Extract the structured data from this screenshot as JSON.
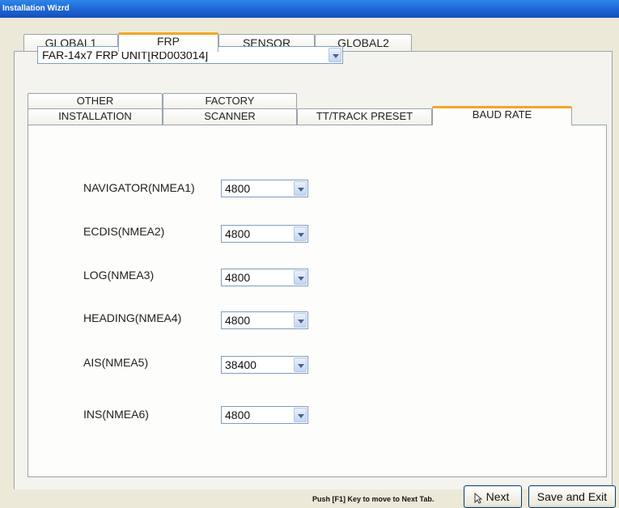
{
  "window": {
    "title": "Installation Wizrd"
  },
  "main_tabs": [
    "GLOBAL1",
    "FRP",
    "SENSOR",
    "GLOBAL2"
  ],
  "unit_select": {
    "value": "FAR-14x7 FRP UNIT[RD003014]"
  },
  "sub_tabs_row1": [
    "OTHER",
    "FACTORY"
  ],
  "sub_tabs_row2": [
    "INSTALLATION",
    "SCANNER",
    "TT/TRACK PRESET",
    "BAUD RATE"
  ],
  "baud_rates": [
    {
      "label": "NAVIGATOR(NMEA1)",
      "value": "4800"
    },
    {
      "label": "ECDIS(NMEA2)",
      "value": "4800"
    },
    {
      "label": "LOG(NMEA3)",
      "value": "4800"
    },
    {
      "label": "HEADING(NMEA4)",
      "value": "4800"
    },
    {
      "label": "AIS(NMEA5)",
      "value": "38400"
    },
    {
      "label": "INS(NMEA6)",
      "value": "4800"
    }
  ],
  "footer": {
    "hint": "Push [F1] Key to move to Next Tab.",
    "next_label": "Next",
    "save_exit_label": "Save and Exit"
  },
  "icons": {
    "dropdown": "chevron-down-icon",
    "cursor": "mouse-pointer-icon"
  },
  "colors": {
    "title_bar": "#1d64d4",
    "active_tab_accent": "#f5a623",
    "window_bg": "#ece9d8"
  }
}
